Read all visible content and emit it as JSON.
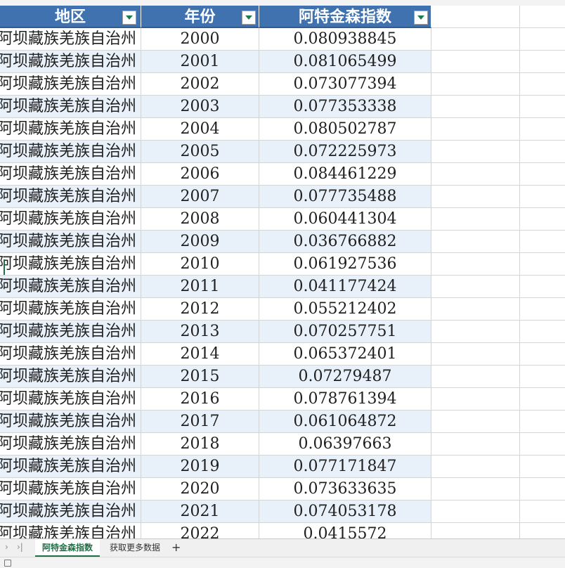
{
  "table": {
    "headers": [
      "地区",
      "年份",
      "阿特金森指数"
    ],
    "rows": [
      {
        "region": "阿坝藏族羌族自治州",
        "year": "2000",
        "value": "0.080938845"
      },
      {
        "region": "阿坝藏族羌族自治州",
        "year": "2001",
        "value": "0.081065499"
      },
      {
        "region": "阿坝藏族羌族自治州",
        "year": "2002",
        "value": "0.073077394"
      },
      {
        "region": "阿坝藏族羌族自治州",
        "year": "2003",
        "value": "0.077353338"
      },
      {
        "region": "阿坝藏族羌族自治州",
        "year": "2004",
        "value": "0.080502787"
      },
      {
        "region": "阿坝藏族羌族自治州",
        "year": "2005",
        "value": "0.072225973"
      },
      {
        "region": "阿坝藏族羌族自治州",
        "year": "2006",
        "value": "0.084461229"
      },
      {
        "region": "阿坝藏族羌族自治州",
        "year": "2007",
        "value": "0.077735488"
      },
      {
        "region": "阿坝藏族羌族自治州",
        "year": "2008",
        "value": "0.060441304"
      },
      {
        "region": "阿坝藏族羌族自治州",
        "year": "2009",
        "value": "0.036766882"
      },
      {
        "region": "阿坝藏族羌族自治州",
        "year": "2010",
        "value": "0.061927536"
      },
      {
        "region": "阿坝藏族羌族自治州",
        "year": "2011",
        "value": "0.041177424"
      },
      {
        "region": "阿坝藏族羌族自治州",
        "year": "2012",
        "value": "0.055212402"
      },
      {
        "region": "阿坝藏族羌族自治州",
        "year": "2013",
        "value": "0.070257751"
      },
      {
        "region": "阿坝藏族羌族自治州",
        "year": "2014",
        "value": "0.065372401"
      },
      {
        "region": "阿坝藏族羌族自治州",
        "year": "2015",
        "value": "0.07279487"
      },
      {
        "region": "阿坝藏族羌族自治州",
        "year": "2016",
        "value": "0.078761394"
      },
      {
        "region": "阿坝藏族羌族自治州",
        "year": "2017",
        "value": "0.061064872"
      },
      {
        "region": "阿坝藏族羌族自治州",
        "year": "2018",
        "value": "0.06397663"
      },
      {
        "region": "阿坝藏族羌族自治州",
        "year": "2019",
        "value": "0.077171847"
      },
      {
        "region": "阿坝藏族羌族自治州",
        "year": "2020",
        "value": "0.073633635"
      },
      {
        "region": "阿坝藏族羌族自治州",
        "year": "2021",
        "value": "0.074053178"
      },
      {
        "region": "阿坝藏族羌族自治州",
        "year": "2022",
        "value": "0.0415572"
      }
    ]
  },
  "sheet_tabs": {
    "nav_prev_icon": "chevron-right-icon",
    "nav_last_icon": "skip-last-icon",
    "tabs": [
      "阿特金森指数",
      "获取更多数据"
    ],
    "active_index": 0,
    "add_label": "+"
  },
  "colors": {
    "header_bg": "#3f72af",
    "band_bg": "#e8f0fa",
    "active_accent": "#1e7145"
  }
}
